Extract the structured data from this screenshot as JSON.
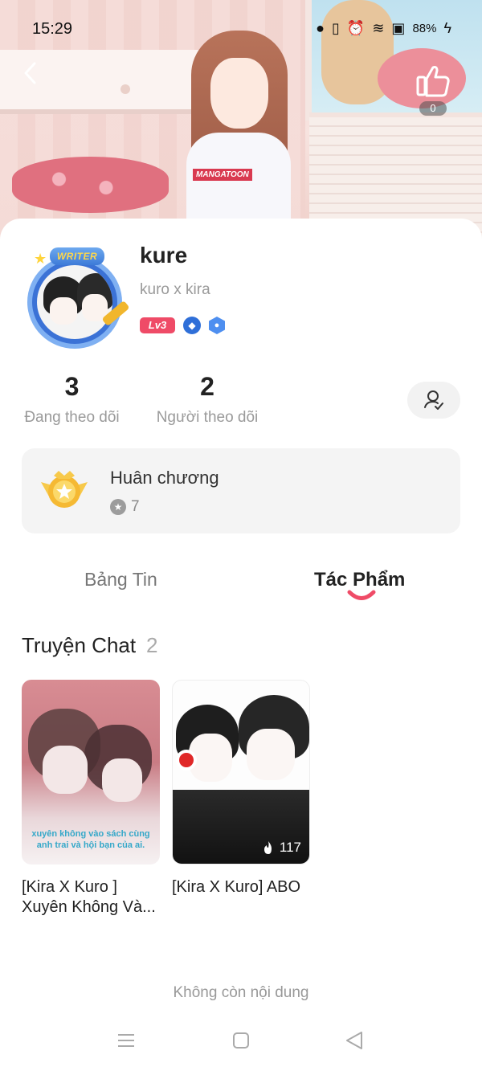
{
  "status_bar": {
    "time": "15:29",
    "battery": "88%"
  },
  "hero": {
    "shirt_text": "MANGATOON",
    "like_count": "0"
  },
  "profile": {
    "avatar_banner": "WRITER",
    "username": "kure",
    "nickname": "kuro x kira",
    "level_badge": "Lv3"
  },
  "stats": {
    "following_count": "3",
    "following_label": "Đang theo dõi",
    "followers_count": "2",
    "followers_label": "Người theo dõi"
  },
  "medals": {
    "title": "Huân chương",
    "count": "7"
  },
  "tabs": [
    {
      "label": "Bảng Tin",
      "active": false
    },
    {
      "label": "Tác Phẩm",
      "active": true
    }
  ],
  "section": {
    "title": "Truyện Chat",
    "count": "2"
  },
  "works": [
    {
      "title": "[Kira X Kuro ] Xuyên Không Và...",
      "cover_caption": "xuyên không vào sách cùng anh trai và hội bạn của ai."
    },
    {
      "title": "[Kira X Kuro] ABO",
      "views": "117"
    }
  ],
  "end_text": "Không còn nội dung",
  "colors": {
    "accent": "#ef4b67",
    "badge_blue": "#2f6fd8",
    "muted_text": "#9a9a9a"
  }
}
